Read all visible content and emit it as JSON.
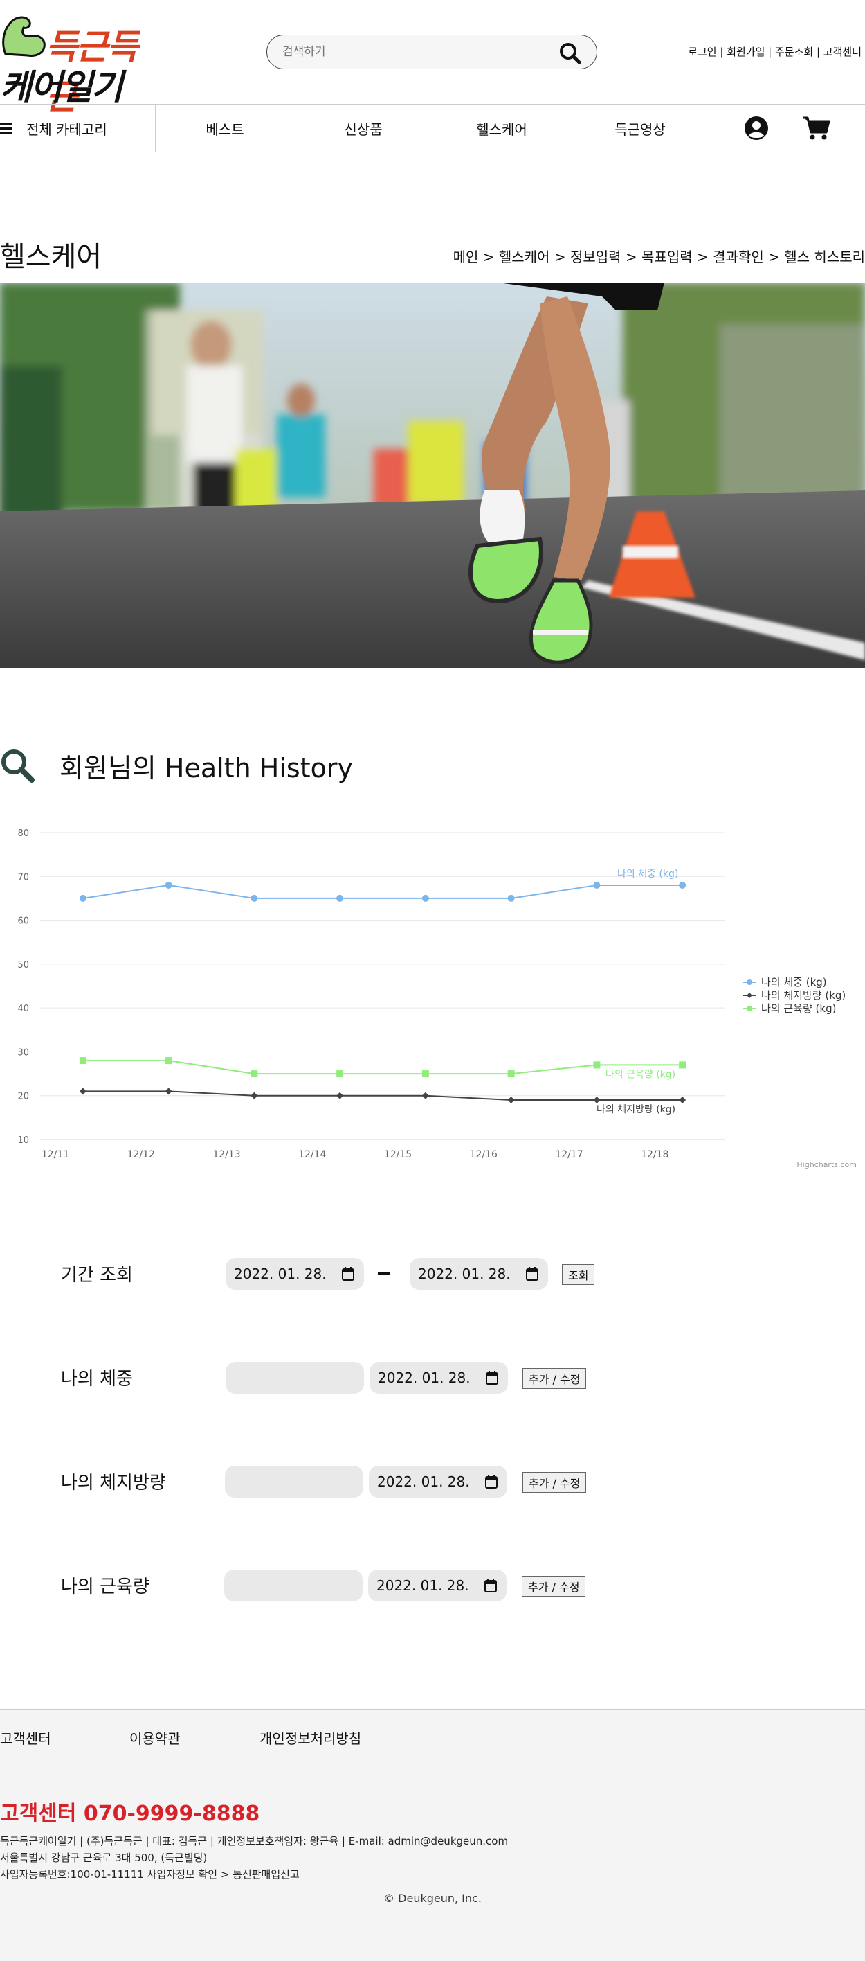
{
  "logo": {
    "line1": "득근득근",
    "line2": "케어일기"
  },
  "search": {
    "placeholder": "검색하기"
  },
  "top_links": [
    "로그인",
    "회원가입",
    "주문조회",
    "고객센터"
  ],
  "nav": {
    "all": "전체 카테고리",
    "items": [
      "베스트",
      "신상품",
      "헬스케어",
      "득근영상"
    ]
  },
  "page_title": "헬스케어",
  "breadcrumb": [
    "메인",
    "헬스케어",
    "정보입력",
    "목표입력",
    "결과확인",
    "헬스 히스토리"
  ],
  "section_title": "회원님의 Health History",
  "chart_data": {
    "type": "line",
    "categories": [
      "12/11",
      "12/12",
      "12/13",
      "12/14",
      "12/15",
      "12/16",
      "12/17",
      "12/18"
    ],
    "ylim": [
      10,
      80
    ],
    "yticks": [
      10,
      20,
      30,
      40,
      50,
      60,
      70,
      80
    ],
    "series": [
      {
        "name": "나의 체중 (kg)",
        "color": "#7cb5ec",
        "marker": "circle",
        "values": [
          65,
          68,
          65,
          65,
          65,
          65,
          68,
          68
        ]
      },
      {
        "name": "나의 체지방량 (kg)",
        "color": "#434348",
        "marker": "diamond",
        "values": [
          21,
          21,
          20,
          20,
          20,
          19,
          19,
          19
        ]
      },
      {
        "name": "나의 근육량 (kg)",
        "color": "#90ed7d",
        "marker": "square",
        "values": [
          28,
          28,
          25,
          25,
          25,
          25,
          27,
          27
        ]
      }
    ],
    "legend": "right",
    "credit": "Highcharts.com",
    "grid": true
  },
  "form": {
    "period_label": "기간 조회",
    "period_from": "2022. 01. 28.",
    "period_to": "2022. 01. 28.",
    "query_button": "조회",
    "rows": [
      {
        "label": "나의 체중",
        "date": "2022. 01. 28.",
        "button": "추가 / 수정"
      },
      {
        "label": "나의 체지방량",
        "date": "2022. 01. 28.",
        "button": "추가 / 수정"
      },
      {
        "label": "나의 근육량",
        "date": "2022. 01. 28.",
        "button": "추가 / 수정"
      }
    ]
  },
  "footer": {
    "links": [
      "고객센터",
      "이용약관",
      "개인정보처리방침"
    ],
    "cs": "고객센터 070-9999-8888",
    "info1": "득근득근케어일기 | (주)득근득근 | 대표: 김득근 | 개인정보보호책임자: 왕근육 | E-mail: admin@deukgeun.com",
    "info2": "서울특별시 강남구 근육로 3대 500, (득근빌딩)",
    "info3": "사업자등록번호:100-01-11111 사업자정보 확인 > 통신판매업신고",
    "copyright": "© Deukgeun, Inc."
  }
}
